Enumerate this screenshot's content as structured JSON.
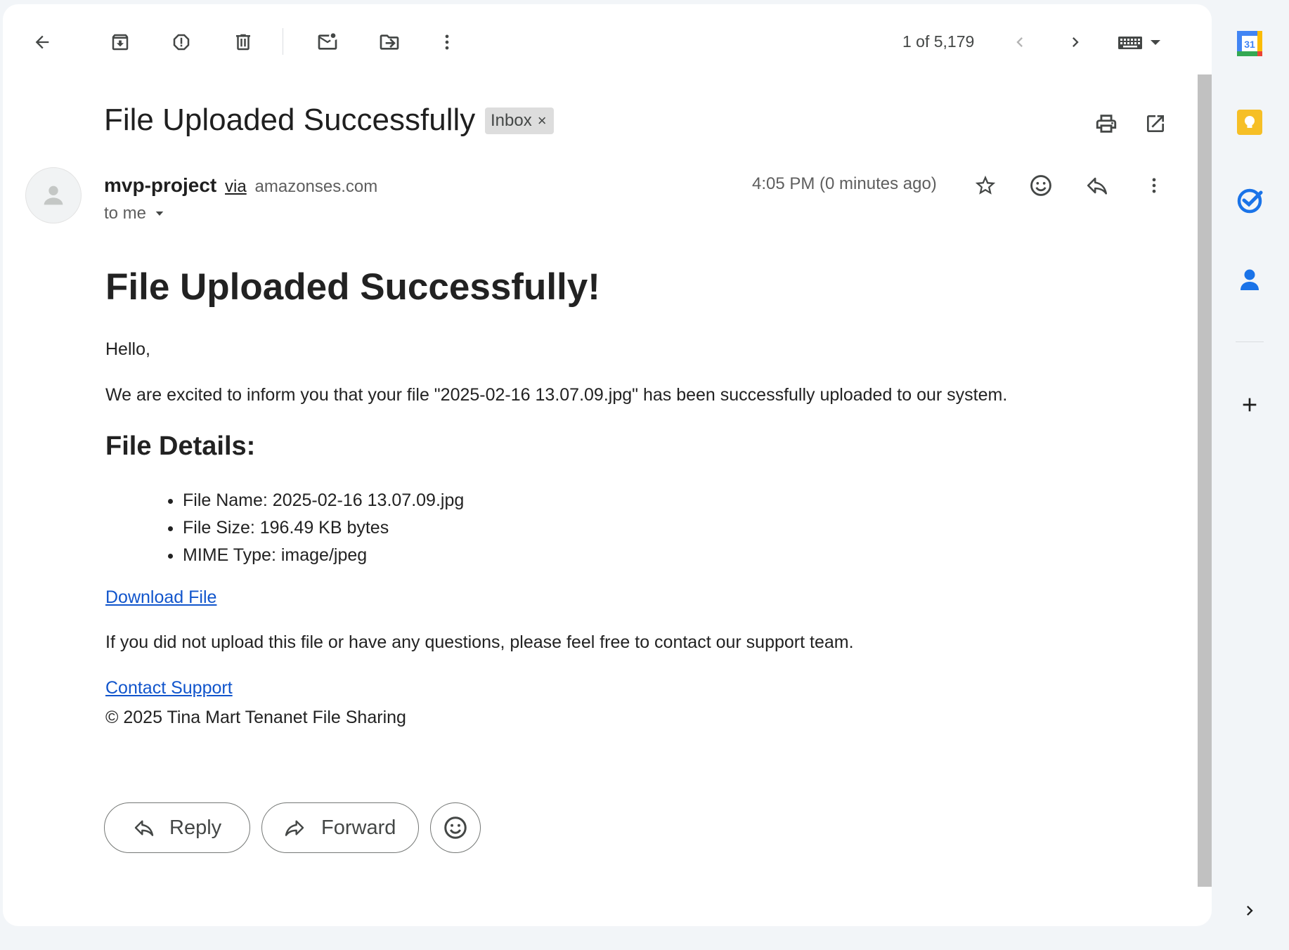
{
  "toolbar": {
    "pager": "1 of 5,179"
  },
  "message": {
    "subject": "File Uploaded Successfully",
    "label_chip": "Inbox",
    "label_remove": "×",
    "sender_name": "mvp-project",
    "sender_via": "via",
    "sender_domain": "amazonses.com",
    "recipient": "to me",
    "time": "4:05 PM (0 minutes ago)"
  },
  "email_body": {
    "heading": "File Uploaded Successfully!",
    "greeting": "Hello,",
    "intro": "We are excited to inform you that your file \"2025-02-16 13.07.09.jpg\" has been successfully uploaded to our system.",
    "details_heading": "File Details:",
    "details": [
      "File Name: 2025-02-16 13.07.09.jpg",
      "File Size: 196.49 KB bytes",
      "MIME Type: image/jpeg"
    ],
    "download_link": "Download File",
    "support_text": "If you did not upload this file or have any questions, please feel free to contact our support team.",
    "support_link": "Contact Support",
    "footer": "© 2025 Tina Mart Tenanet File Sharing"
  },
  "actions": {
    "reply": "Reply",
    "forward": "Forward"
  },
  "side_panel": {
    "calendar_day": "31"
  },
  "colors": {
    "link": "#1155cc",
    "calendar_blue": "#4285f4",
    "keep_yellow": "#f6bf26",
    "tasks_blue": "#1a73e8",
    "contacts_blue": "#1a73e8"
  },
  "icons": {
    "toolbar": [
      "back-arrow-icon",
      "archive-icon",
      "report-spam-icon",
      "delete-icon",
      "mark-unread-icon",
      "move-to-icon",
      "more-vert-icon",
      "chevron-left-icon",
      "chevron-right-icon",
      "keyboard-icon"
    ],
    "header": [
      "print-icon",
      "open-new-window-icon",
      "star-icon",
      "emoji-icon",
      "reply-icon",
      "more-vert-icon"
    ],
    "side": [
      "calendar-icon",
      "keep-icon",
      "tasks-icon",
      "contacts-icon",
      "add-icon",
      "expand-icon"
    ]
  }
}
